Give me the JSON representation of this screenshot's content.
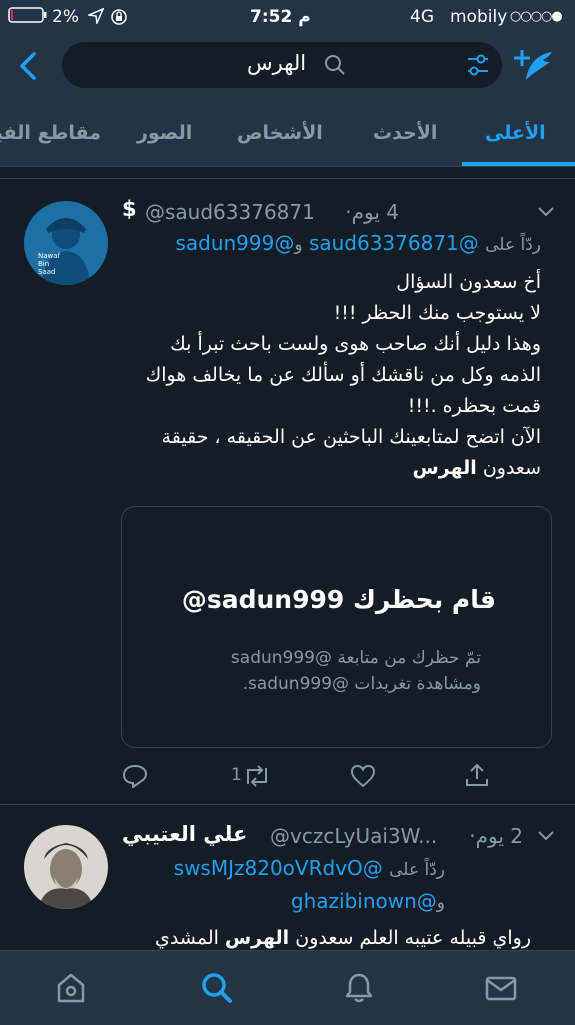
{
  "status": {
    "carrier": "mobily",
    "signal": "○○○○●",
    "network": "4G",
    "time": "7:52 م",
    "battery": "2%"
  },
  "search": {
    "query": "الهرس"
  },
  "tabs": [
    {
      "label": "الأعلى",
      "active": true
    },
    {
      "label": "الأحدث",
      "active": false
    },
    {
      "label": "الأشخاص",
      "active": false
    },
    {
      "label": "الصور",
      "active": false
    },
    {
      "label": "مقاطع الفيديو",
      "active": false
    }
  ],
  "tweets": [
    {
      "display_name": "$",
      "handle": "@saud63376871",
      "time": "4 يوم",
      "reply_prefix": "ردّاً على",
      "reply_to_1": "@saud63376871",
      "reply_conj": "و",
      "reply_to_2": "@sadun999",
      "avatar_text": [
        "Nawaf",
        "Bin",
        "Saad"
      ],
      "lines": [
        "أخ سعدون السؤال",
        "لا يستوجب منك الحظر !!!",
        "وهذا دليل أنك صاحب هوى ولست باحث تبرأ بك",
        "الذمه وكل من ناقشك أو سألك عن ما يخالف هواك",
        "قمت بحظره .!!!",
        "الآن اتضح لمتابعينك الباحثين عن الحقيقه ، حقيقة"
      ],
      "last_line_prefix": "سعدون",
      "last_line_bold": "الهرس",
      "card": {
        "title": "@sadun999 قام بحظرك",
        "body_1": "تمّ حظرك من متابعة @sadun999",
        "body_2": "ومشاهدة تغريدات @sadun999."
      },
      "retweets": "1"
    },
    {
      "display_name": "علي العتيبي",
      "handle": "@vczcLyUai3W...",
      "time": "2 يوم",
      "reply_prefix": "ردّاً على",
      "reply_to_1": "@swsMJz820oVRdvO",
      "reply_conj": "و",
      "reply_to_2": "@ghazibinown",
      "text_start": "رواي قبيله عتيبه العلم سعدون",
      "text_bold": "الهرس",
      "text_end": "المشدي"
    }
  ],
  "colors": {
    "accent": "#1da1f2",
    "bar": "#243447",
    "background": "#141d26"
  },
  "icons": [
    "back-arrow-icon",
    "search-icon",
    "filter-icon",
    "compose-icon",
    "chevron-down-icon",
    "reply-icon",
    "retweet-icon",
    "like-icon",
    "share-icon",
    "home-icon",
    "notifications-icon",
    "messages-icon"
  ]
}
